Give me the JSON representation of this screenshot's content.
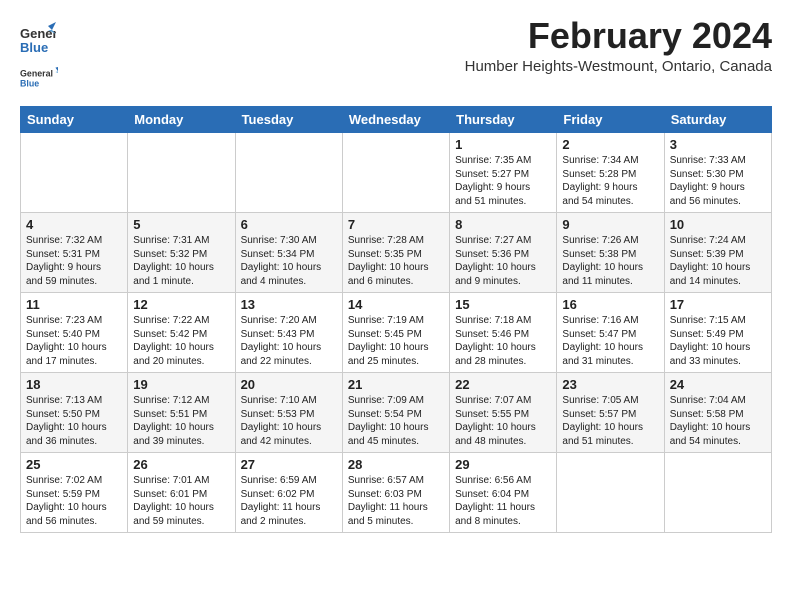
{
  "logo": {
    "general": "General",
    "blue": "Blue"
  },
  "header": {
    "month": "February 2024",
    "location": "Humber Heights-Westmount, Ontario, Canada"
  },
  "days": [
    "Sunday",
    "Monday",
    "Tuesday",
    "Wednesday",
    "Thursday",
    "Friday",
    "Saturday"
  ],
  "weeks": [
    [
      {
        "day": "",
        "info": ""
      },
      {
        "day": "",
        "info": ""
      },
      {
        "day": "",
        "info": ""
      },
      {
        "day": "",
        "info": ""
      },
      {
        "day": "1",
        "info": "Sunrise: 7:35 AM\nSunset: 5:27 PM\nDaylight: 9 hours\nand 51 minutes."
      },
      {
        "day": "2",
        "info": "Sunrise: 7:34 AM\nSunset: 5:28 PM\nDaylight: 9 hours\nand 54 minutes."
      },
      {
        "day": "3",
        "info": "Sunrise: 7:33 AM\nSunset: 5:30 PM\nDaylight: 9 hours\nand 56 minutes."
      }
    ],
    [
      {
        "day": "4",
        "info": "Sunrise: 7:32 AM\nSunset: 5:31 PM\nDaylight: 9 hours\nand 59 minutes."
      },
      {
        "day": "5",
        "info": "Sunrise: 7:31 AM\nSunset: 5:32 PM\nDaylight: 10 hours\nand 1 minute."
      },
      {
        "day": "6",
        "info": "Sunrise: 7:30 AM\nSunset: 5:34 PM\nDaylight: 10 hours\nand 4 minutes."
      },
      {
        "day": "7",
        "info": "Sunrise: 7:28 AM\nSunset: 5:35 PM\nDaylight: 10 hours\nand 6 minutes."
      },
      {
        "day": "8",
        "info": "Sunrise: 7:27 AM\nSunset: 5:36 PM\nDaylight: 10 hours\nand 9 minutes."
      },
      {
        "day": "9",
        "info": "Sunrise: 7:26 AM\nSunset: 5:38 PM\nDaylight: 10 hours\nand 11 minutes."
      },
      {
        "day": "10",
        "info": "Sunrise: 7:24 AM\nSunset: 5:39 PM\nDaylight: 10 hours\nand 14 minutes."
      }
    ],
    [
      {
        "day": "11",
        "info": "Sunrise: 7:23 AM\nSunset: 5:40 PM\nDaylight: 10 hours\nand 17 minutes."
      },
      {
        "day": "12",
        "info": "Sunrise: 7:22 AM\nSunset: 5:42 PM\nDaylight: 10 hours\nand 20 minutes."
      },
      {
        "day": "13",
        "info": "Sunrise: 7:20 AM\nSunset: 5:43 PM\nDaylight: 10 hours\nand 22 minutes."
      },
      {
        "day": "14",
        "info": "Sunrise: 7:19 AM\nSunset: 5:45 PM\nDaylight: 10 hours\nand 25 minutes."
      },
      {
        "day": "15",
        "info": "Sunrise: 7:18 AM\nSunset: 5:46 PM\nDaylight: 10 hours\nand 28 minutes."
      },
      {
        "day": "16",
        "info": "Sunrise: 7:16 AM\nSunset: 5:47 PM\nDaylight: 10 hours\nand 31 minutes."
      },
      {
        "day": "17",
        "info": "Sunrise: 7:15 AM\nSunset: 5:49 PM\nDaylight: 10 hours\nand 33 minutes."
      }
    ],
    [
      {
        "day": "18",
        "info": "Sunrise: 7:13 AM\nSunset: 5:50 PM\nDaylight: 10 hours\nand 36 minutes."
      },
      {
        "day": "19",
        "info": "Sunrise: 7:12 AM\nSunset: 5:51 PM\nDaylight: 10 hours\nand 39 minutes."
      },
      {
        "day": "20",
        "info": "Sunrise: 7:10 AM\nSunset: 5:53 PM\nDaylight: 10 hours\nand 42 minutes."
      },
      {
        "day": "21",
        "info": "Sunrise: 7:09 AM\nSunset: 5:54 PM\nDaylight: 10 hours\nand 45 minutes."
      },
      {
        "day": "22",
        "info": "Sunrise: 7:07 AM\nSunset: 5:55 PM\nDaylight: 10 hours\nand 48 minutes."
      },
      {
        "day": "23",
        "info": "Sunrise: 7:05 AM\nSunset: 5:57 PM\nDaylight: 10 hours\nand 51 minutes."
      },
      {
        "day": "24",
        "info": "Sunrise: 7:04 AM\nSunset: 5:58 PM\nDaylight: 10 hours\nand 54 minutes."
      }
    ],
    [
      {
        "day": "25",
        "info": "Sunrise: 7:02 AM\nSunset: 5:59 PM\nDaylight: 10 hours\nand 56 minutes."
      },
      {
        "day": "26",
        "info": "Sunrise: 7:01 AM\nSunset: 6:01 PM\nDaylight: 10 hours\nand 59 minutes."
      },
      {
        "day": "27",
        "info": "Sunrise: 6:59 AM\nSunset: 6:02 PM\nDaylight: 11 hours\nand 2 minutes."
      },
      {
        "day": "28",
        "info": "Sunrise: 6:57 AM\nSunset: 6:03 PM\nDaylight: 11 hours\nand 5 minutes."
      },
      {
        "day": "29",
        "info": "Sunrise: 6:56 AM\nSunset: 6:04 PM\nDaylight: 11 hours\nand 8 minutes."
      },
      {
        "day": "",
        "info": ""
      },
      {
        "day": "",
        "info": ""
      }
    ]
  ]
}
